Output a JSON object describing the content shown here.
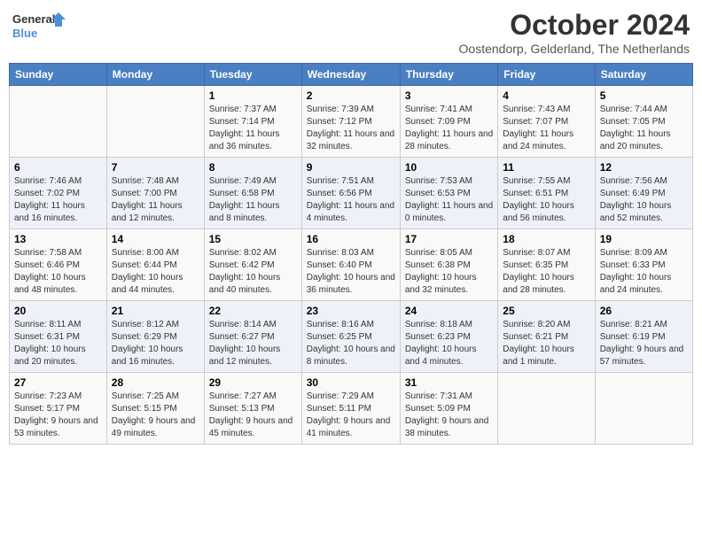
{
  "header": {
    "logo_line1": "General",
    "logo_line2": "Blue",
    "main_title": "October 2024",
    "subtitle": "Oostendorp, Gelderland, The Netherlands"
  },
  "days_of_week": [
    "Sunday",
    "Monday",
    "Tuesday",
    "Wednesday",
    "Thursday",
    "Friday",
    "Saturday"
  ],
  "weeks": [
    [
      {
        "day": "",
        "detail": ""
      },
      {
        "day": "",
        "detail": ""
      },
      {
        "day": "1",
        "detail": "Sunrise: 7:37 AM\nSunset: 7:14 PM\nDaylight: 11 hours and 36 minutes."
      },
      {
        "day": "2",
        "detail": "Sunrise: 7:39 AM\nSunset: 7:12 PM\nDaylight: 11 hours and 32 minutes."
      },
      {
        "day": "3",
        "detail": "Sunrise: 7:41 AM\nSunset: 7:09 PM\nDaylight: 11 hours and 28 minutes."
      },
      {
        "day": "4",
        "detail": "Sunrise: 7:43 AM\nSunset: 7:07 PM\nDaylight: 11 hours and 24 minutes."
      },
      {
        "day": "5",
        "detail": "Sunrise: 7:44 AM\nSunset: 7:05 PM\nDaylight: 11 hours and 20 minutes."
      }
    ],
    [
      {
        "day": "6",
        "detail": "Sunrise: 7:46 AM\nSunset: 7:02 PM\nDaylight: 11 hours and 16 minutes."
      },
      {
        "day": "7",
        "detail": "Sunrise: 7:48 AM\nSunset: 7:00 PM\nDaylight: 11 hours and 12 minutes."
      },
      {
        "day": "8",
        "detail": "Sunrise: 7:49 AM\nSunset: 6:58 PM\nDaylight: 11 hours and 8 minutes."
      },
      {
        "day": "9",
        "detail": "Sunrise: 7:51 AM\nSunset: 6:56 PM\nDaylight: 11 hours and 4 minutes."
      },
      {
        "day": "10",
        "detail": "Sunrise: 7:53 AM\nSunset: 6:53 PM\nDaylight: 11 hours and 0 minutes."
      },
      {
        "day": "11",
        "detail": "Sunrise: 7:55 AM\nSunset: 6:51 PM\nDaylight: 10 hours and 56 minutes."
      },
      {
        "day": "12",
        "detail": "Sunrise: 7:56 AM\nSunset: 6:49 PM\nDaylight: 10 hours and 52 minutes."
      }
    ],
    [
      {
        "day": "13",
        "detail": "Sunrise: 7:58 AM\nSunset: 6:46 PM\nDaylight: 10 hours and 48 minutes."
      },
      {
        "day": "14",
        "detail": "Sunrise: 8:00 AM\nSunset: 6:44 PM\nDaylight: 10 hours and 44 minutes."
      },
      {
        "day": "15",
        "detail": "Sunrise: 8:02 AM\nSunset: 6:42 PM\nDaylight: 10 hours and 40 minutes."
      },
      {
        "day": "16",
        "detail": "Sunrise: 8:03 AM\nSunset: 6:40 PM\nDaylight: 10 hours and 36 minutes."
      },
      {
        "day": "17",
        "detail": "Sunrise: 8:05 AM\nSunset: 6:38 PM\nDaylight: 10 hours and 32 minutes."
      },
      {
        "day": "18",
        "detail": "Sunrise: 8:07 AM\nSunset: 6:35 PM\nDaylight: 10 hours and 28 minutes."
      },
      {
        "day": "19",
        "detail": "Sunrise: 8:09 AM\nSunset: 6:33 PM\nDaylight: 10 hours and 24 minutes."
      }
    ],
    [
      {
        "day": "20",
        "detail": "Sunrise: 8:11 AM\nSunset: 6:31 PM\nDaylight: 10 hours and 20 minutes."
      },
      {
        "day": "21",
        "detail": "Sunrise: 8:12 AM\nSunset: 6:29 PM\nDaylight: 10 hours and 16 minutes."
      },
      {
        "day": "22",
        "detail": "Sunrise: 8:14 AM\nSunset: 6:27 PM\nDaylight: 10 hours and 12 minutes."
      },
      {
        "day": "23",
        "detail": "Sunrise: 8:16 AM\nSunset: 6:25 PM\nDaylight: 10 hours and 8 minutes."
      },
      {
        "day": "24",
        "detail": "Sunrise: 8:18 AM\nSunset: 6:23 PM\nDaylight: 10 hours and 4 minutes."
      },
      {
        "day": "25",
        "detail": "Sunrise: 8:20 AM\nSunset: 6:21 PM\nDaylight: 10 hours and 1 minute."
      },
      {
        "day": "26",
        "detail": "Sunrise: 8:21 AM\nSunset: 6:19 PM\nDaylight: 9 hours and 57 minutes."
      }
    ],
    [
      {
        "day": "27",
        "detail": "Sunrise: 7:23 AM\nSunset: 5:17 PM\nDaylight: 9 hours and 53 minutes."
      },
      {
        "day": "28",
        "detail": "Sunrise: 7:25 AM\nSunset: 5:15 PM\nDaylight: 9 hours and 49 minutes."
      },
      {
        "day": "29",
        "detail": "Sunrise: 7:27 AM\nSunset: 5:13 PM\nDaylight: 9 hours and 45 minutes."
      },
      {
        "day": "30",
        "detail": "Sunrise: 7:29 AM\nSunset: 5:11 PM\nDaylight: 9 hours and 41 minutes."
      },
      {
        "day": "31",
        "detail": "Sunrise: 7:31 AM\nSunset: 5:09 PM\nDaylight: 9 hours and 38 minutes."
      },
      {
        "day": "",
        "detail": ""
      },
      {
        "day": "",
        "detail": ""
      }
    ]
  ]
}
